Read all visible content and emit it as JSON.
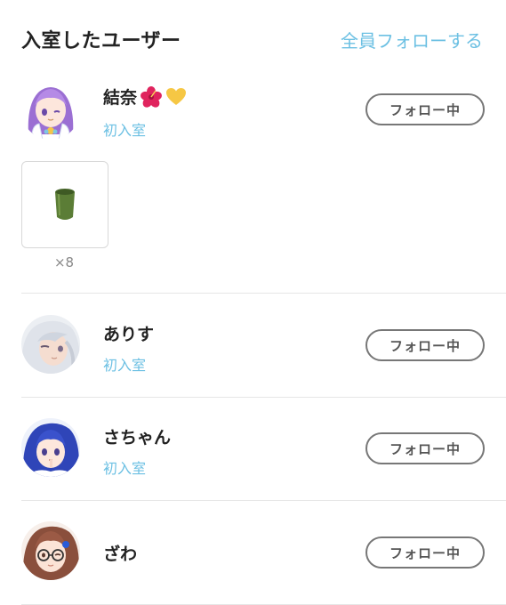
{
  "header": {
    "title": "入室したユーザー",
    "follow_all": "全員フォローする"
  },
  "users": [
    {
      "name": "結奈",
      "sub": "初入室",
      "follow_label": "フォロー中",
      "badges": [
        "hibiscus-icon",
        "yellow-heart-icon"
      ],
      "gift": {
        "icon": "green-jar-icon",
        "count": "×8"
      }
    },
    {
      "name": "ありす",
      "sub": "初入室",
      "follow_label": "フォロー中"
    },
    {
      "name": "さちゃん",
      "sub": "初入室",
      "follow_label": "フォロー中"
    },
    {
      "name": "ざわ",
      "follow_label": "フォロー中"
    }
  ],
  "colors": {
    "accent": "#6cc0e3",
    "button_border": "#777777",
    "divider": "#e6e6e6"
  }
}
